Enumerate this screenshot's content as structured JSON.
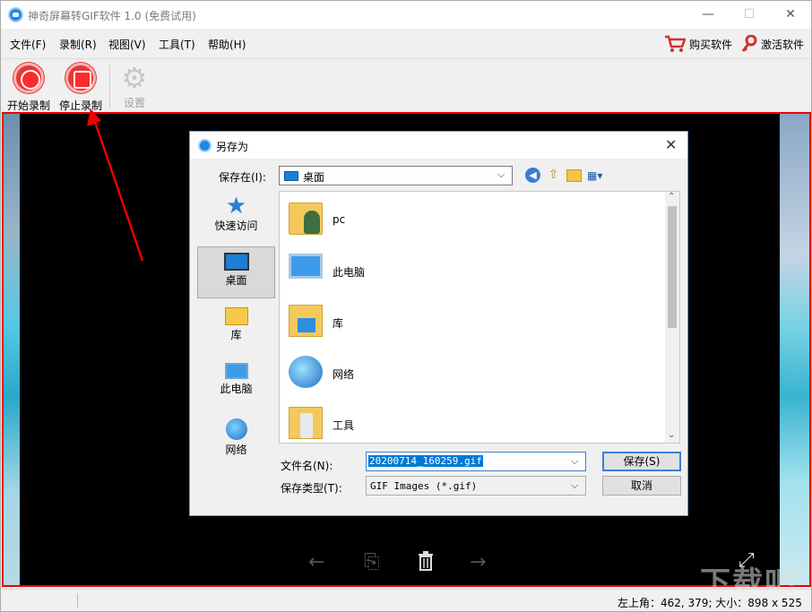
{
  "window": {
    "title": "神奇屏幕转GIF软件 1.0 (免费试用)",
    "min": "—",
    "max": "☐",
    "close": "✕"
  },
  "menu": {
    "items": [
      "文件(F)",
      "录制(R)",
      "视图(V)",
      "工具(T)",
      "帮助(H)"
    ],
    "buy_label": "购买软件",
    "activate_label": "激活软件"
  },
  "toolbar": {
    "start_label": "开始录制",
    "stop_label": "停止录制",
    "settings_label": "设置"
  },
  "viewer": {
    "prev": "←",
    "frame": "⎘",
    "delete": "🗑",
    "next": "→",
    "fullscreen": "⤢"
  },
  "dialog": {
    "title": "另存为",
    "close": "✕",
    "save_in_label": "保存在(I):",
    "save_in_value": "桌面",
    "places": [
      "快速访问",
      "桌面",
      "库",
      "此电脑",
      "网络"
    ],
    "selected_place": "桌面",
    "files": [
      "pc",
      "此电脑",
      "库",
      "网络",
      "工具"
    ],
    "filename_label": "文件名(N):",
    "filename_value": "20200714_160259.gif",
    "filetype_label": "保存类型(T):",
    "filetype_value": "GIF Images (*.gif)",
    "save_button": "保存(S)",
    "cancel_button": "取消"
  },
  "status": {
    "text": "左上角：462, 379; 大小：898 x 525"
  },
  "watermark": "下载吧",
  "colors": {
    "record_red": "#e53935",
    "capture_border": "#e00000",
    "accent_blue": "#0078d7"
  }
}
